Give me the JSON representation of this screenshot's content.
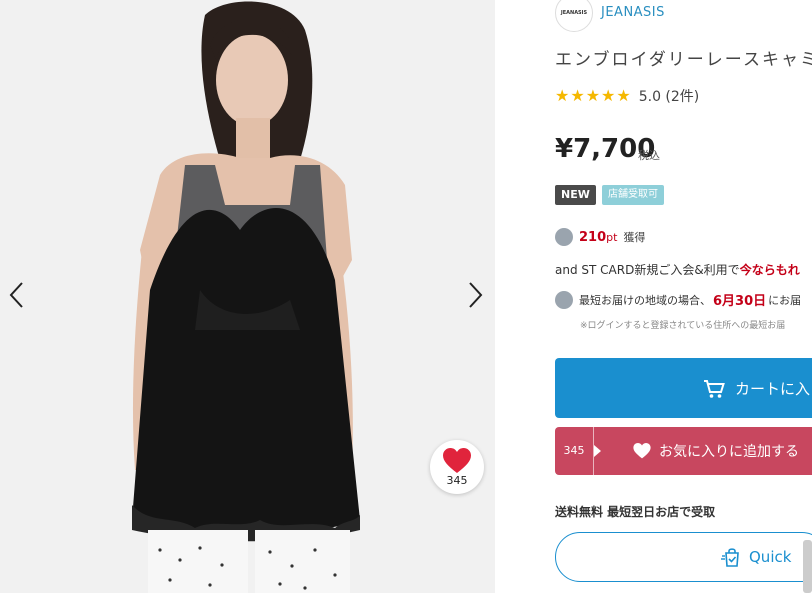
{
  "brand": {
    "logo_text": "JEANASIS",
    "name": "JEANASIS"
  },
  "product": {
    "title": "エンブロイダリーレースキャミ",
    "rating_value": "5.0 (2件)",
    "stars": 5,
    "price": "¥7,700",
    "tax_label": "税込"
  },
  "badges": {
    "new": "NEW",
    "store_pickup": "店舗受取可"
  },
  "points": {
    "amount": "210",
    "unit": "pt",
    "label": "獲得"
  },
  "card_promo": {
    "text": "and ST CARD新規ご入会&利用で",
    "highlight": "今ならもれ"
  },
  "delivery": {
    "prefix": "最短お届けの地域の場合、",
    "date": "6月30日",
    "suffix": "にお届"
  },
  "login_note": "※ログインすると登録されている住所への最短お届",
  "buttons": {
    "cart": "カートに入",
    "favorite_count": "345",
    "favorite": "お気に入りに追加する",
    "quick": "Quick"
  },
  "shipping_note": "送料無料 最短翌日お店で受取",
  "gallery": {
    "favorite_count": "345"
  },
  "colors": {
    "accent_blue": "#1a8fcf",
    "favorite_pink": "#c8475f",
    "price_red": "#c40018",
    "star_yellow": "#f5b800"
  },
  "icons": [
    "chevron-left-icon",
    "chevron-right-icon",
    "heart-icon",
    "cart-icon",
    "point-icon",
    "truck-icon",
    "bag-icon"
  ]
}
